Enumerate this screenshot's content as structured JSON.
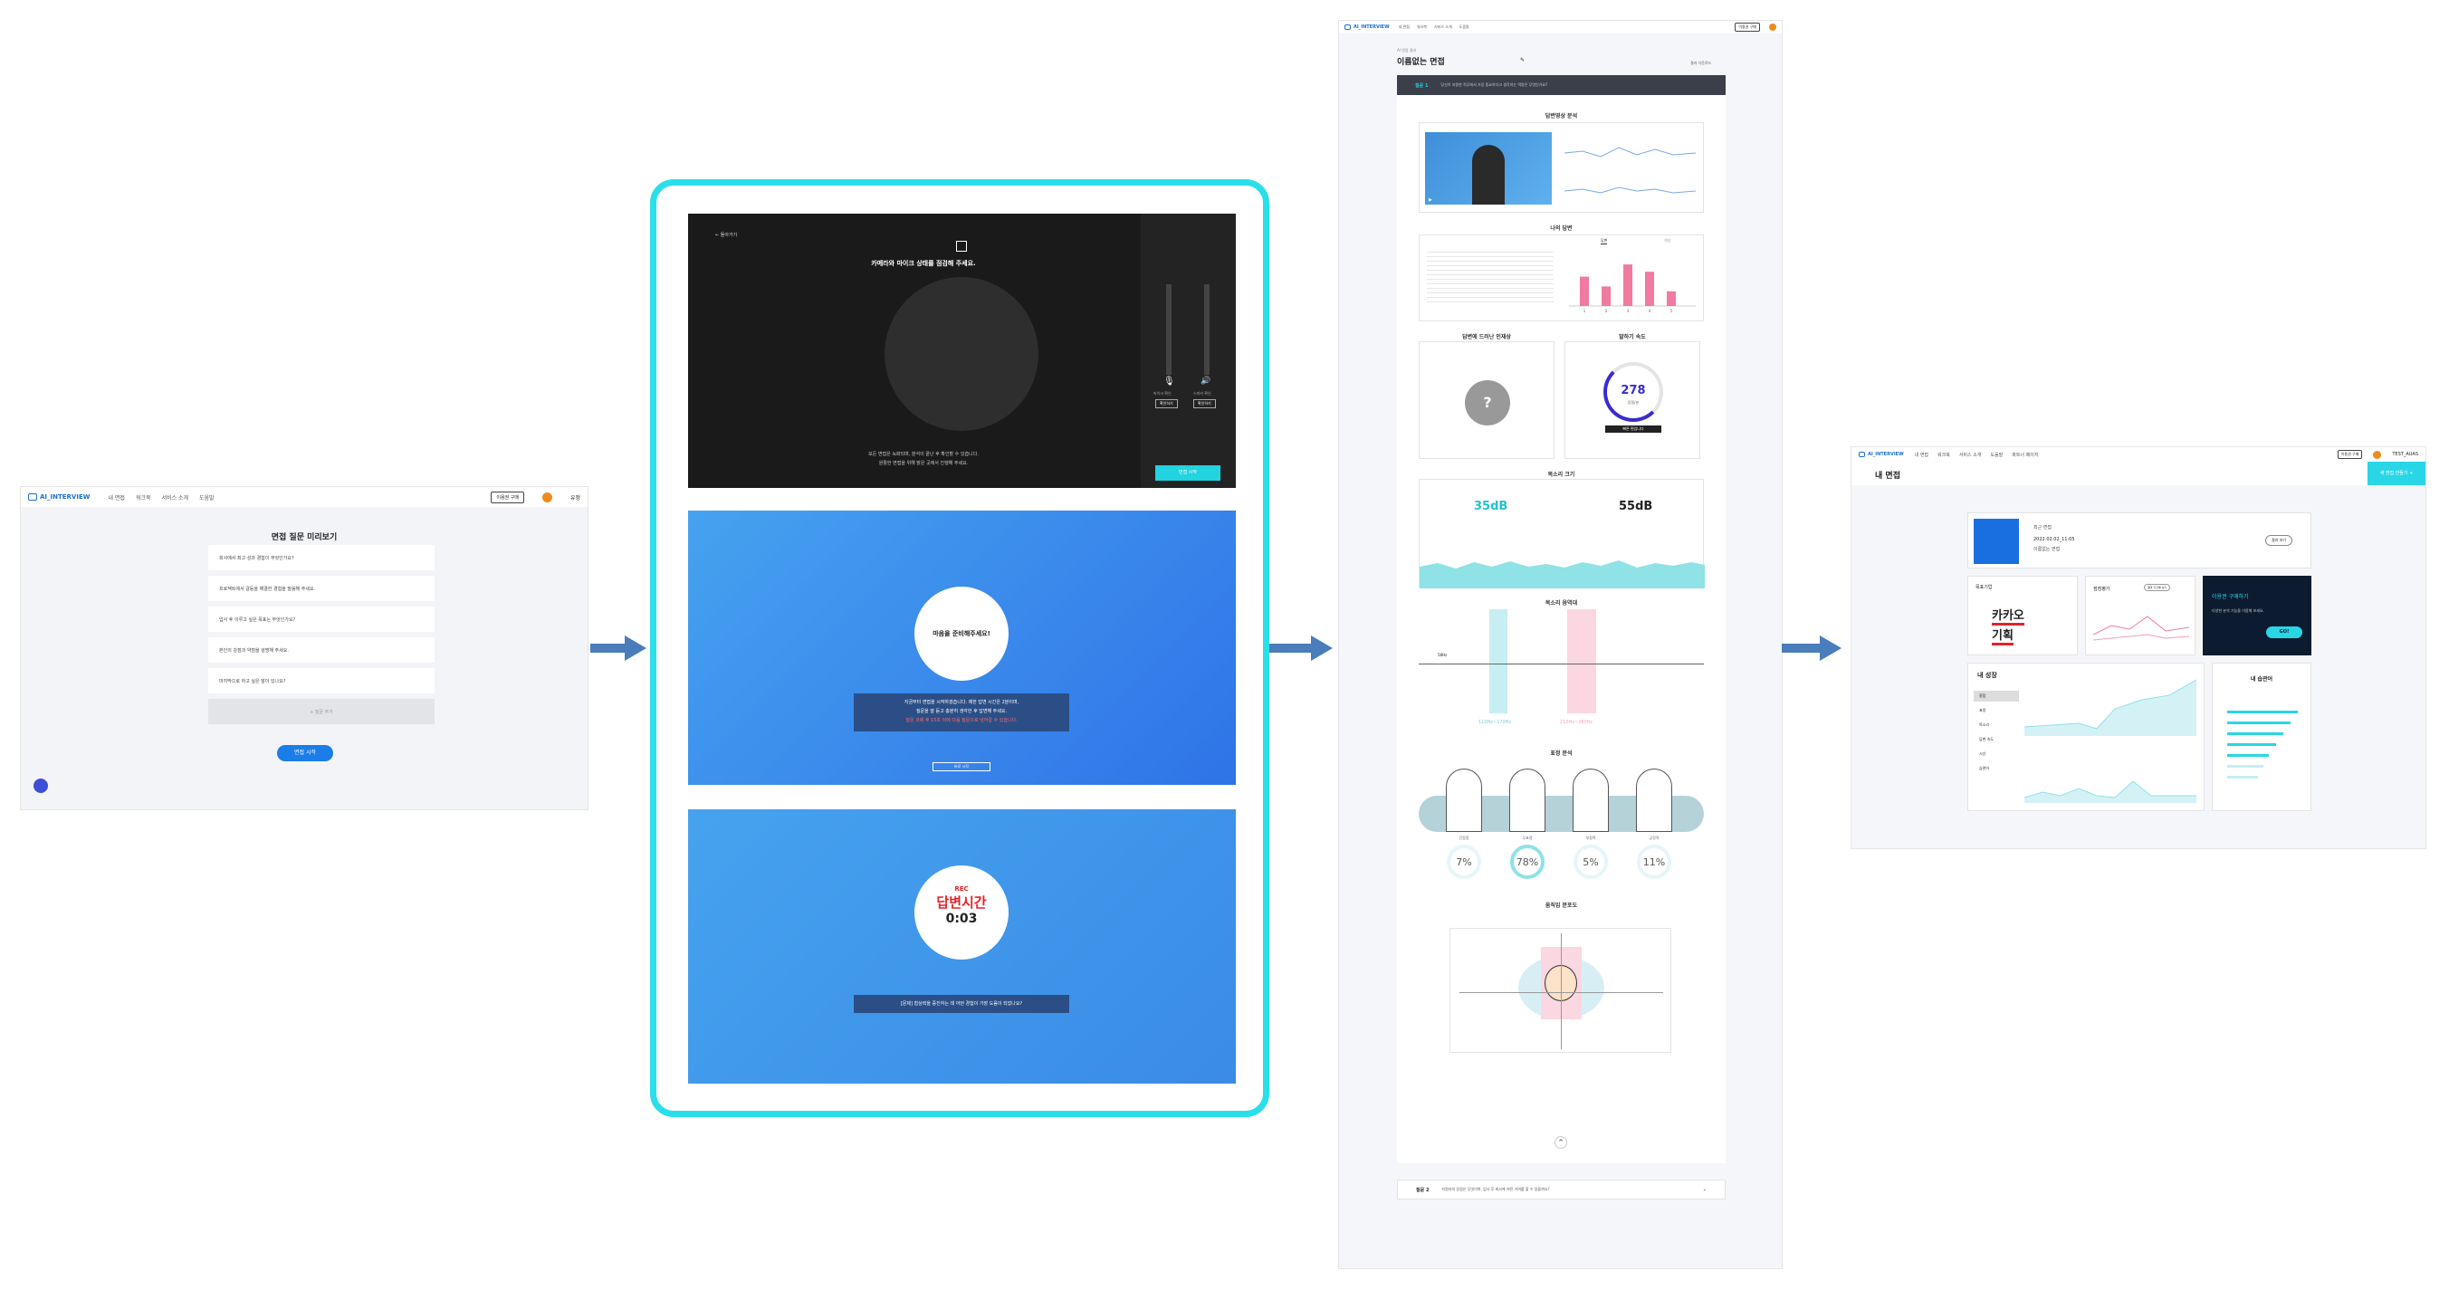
{
  "app": {
    "logo_text": "AI_INTERVIEW",
    "nav": [
      "내 면접",
      "워크북",
      "서비스 소개",
      "도움말"
    ],
    "nav4": [
      "내 면접",
      "워크북",
      "서비스 소개",
      "도움말",
      "파트너 페이지"
    ],
    "buy_label": "이용권 구매",
    "user": "유정",
    "user2": "TEST_AUAS"
  },
  "preview": {
    "title": "면접 질문 미리보기",
    "questions": [
      "회사에서 최고 성과 경험이 무엇인가요?",
      "프로젝트에서 갈등을 해결한 경험을 말씀해 주세요.",
      "입사 후 이루고 싶은 목표는 무엇인가요?",
      "본인의 강점과 약점을 설명해 주세요.",
      "마지막으로 하고 싶은 말이 있나요?"
    ],
    "add_label": "질문 추가",
    "start_label": "면접 시작"
  },
  "camera": {
    "back": "← 돌아가기",
    "title": "카메라와 마이크 상태를 점검해 주세요.",
    "notice": "모든 면접은 녹화되며, 분석이 끝난 후 확인할 수 있습니다.",
    "notice2": "원활한 면접을 위해 밝은 곳에서 진행해 주세요.",
    "mic_label": "마이크 확인",
    "spk_label": "스피커 확인",
    "test1": "확인하기",
    "test2": "확인하기",
    "start": "면접 시작"
  },
  "ready": {
    "bubble": "마음을 준비해주세요!",
    "line1": "지금부터 면접을 시작하겠습니다. 제한 답변 시간은 2분이며,",
    "line2": "질문을 잘 듣고 충분히 생각한 후 답변해 주세요.",
    "warn": "질문 과제 후 15초 뒤에 다음 질문으로 넘어갈 수 있습니다.",
    "skip": "바로 시작"
  },
  "rec": {
    "rec": "REC",
    "label": "답변시간",
    "time": "0:03",
    "question": "[문제] 협상력을 증진하는 데 어떤 경험이 가장 도움이 되었나요?"
  },
  "result": {
    "crumb": "AI 면접 결과",
    "title": "이름없는 면접",
    "download": "결과 다운로드",
    "q1_tag": "질문 1",
    "q1_text": "당신이 지원한 직무에서 가장 중요하다고 생각하는 역량은 무엇인가요?",
    "q2_tag": "질문 2",
    "q2_text": "지원자의 장점은 무엇이며, 입사 후 회사에 어떤 기여를 할 수 있을까요?",
    "s_video": "답변영상 분석",
    "s_ans": "나의 답변",
    "tab_a": "답변",
    "tab_b": "해설",
    "s_keyword": "답변에 드러난 인재상",
    "s_speed": "말하기 속도",
    "unknown": "?",
    "speed": "278",
    "speed_unit": "음절/분",
    "speed_tag": "빠른 편입니다",
    "s_volume": "목소리 크기",
    "db1": "35dB",
    "db2": "55dB",
    "s_pitch": "목소리 음역대",
    "pitch1": "110Hz~170Hz",
    "pitch2": "210Hz~280Hz",
    "pitch_mark": "58Hz",
    "s_emotion": "표정 분석",
    "emotions": [
      {
        "label": "긴장함",
        "pct": "7%"
      },
      {
        "label": "무표정",
        "pct": "78%"
      },
      {
        "label": "부정적",
        "pct": "5%"
      },
      {
        "label": "긍정적",
        "pct": "11%"
      }
    ],
    "s_gaze": "움직임 분포도"
  },
  "my": {
    "title": "내 면접",
    "cta": "새 면접 만들기 +",
    "recent": "최근 면접",
    "date": "2022.02.02_11:05",
    "name": "이름없는 면접",
    "detail": "결과 보기",
    "company_label": "목표기업",
    "company1": "카카오",
    "company2": "기획",
    "comp_label": "점점평가",
    "comp_tag": "결과 기간별 보기",
    "promo1": "이용권 구매하기",
    "promo2": "다양한 분석 기능을 이용해 보세요.",
    "go": "GO!",
    "growth": "내 성장",
    "habit": "내 습관어",
    "menu": [
      "종합",
      "표정",
      "목소리",
      "답변 속도",
      "시선",
      "습관어"
    ]
  },
  "chart_data": {
    "type": "bar",
    "categories": [
      "1",
      "2",
      "3",
      "4",
      "5"
    ],
    "values": [
      60,
      40,
      85,
      70,
      30
    ],
    "title": "",
    "xlabel": "",
    "ylabel": ""
  },
  "colors": {
    "cyan": "#29d6e6",
    "blue": "#3c8dee",
    "pink": "#f07aa0"
  }
}
